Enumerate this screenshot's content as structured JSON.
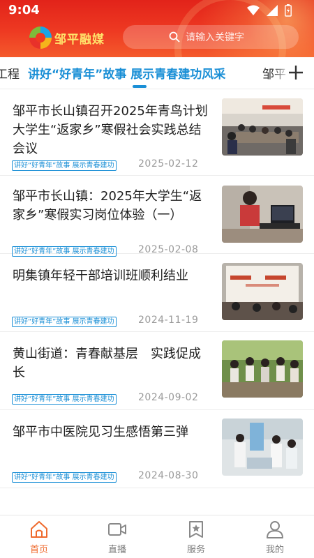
{
  "status_bar": {
    "time": "9:04"
  },
  "header": {
    "brand": "邹平融媒",
    "search_placeholder": "请输入关键字"
  },
  "tabs": {
    "prev": "工程",
    "active": "讲好“好青年”故事 展示青春建功风采",
    "next": "邹平"
  },
  "articles": [
    {
      "title": "邹平市长山镇召开2025年青鸟计划大学生“返家乡”寒假社会实践总结会议",
      "tag": "讲好“好青年”故事  展示青春建功",
      "date": "2025-02-12",
      "image": "meeting-room-photo"
    },
    {
      "title": "邹平市长山镇：2025年大学生“返家乡”寒假实习岗位体验（一）",
      "tag": "讲好“好青年”故事  展示青春建功",
      "date": "2025-02-08",
      "image": "student-laptop-photo"
    },
    {
      "title": "明集镇年轻干部培训班顺利结业",
      "tag": "讲好“好青年”故事  展示青春建功",
      "date": "2024-11-19",
      "image": "training-class-photo"
    },
    {
      "title": "黄山街道：青春献基层　实践促成长",
      "tag": "讲好“好青年”故事  展示青春建功",
      "date": "2024-09-02",
      "image": "group-outdoor-photo"
    },
    {
      "title": "邹平市中医院见习生感悟第三弹",
      "tag": "讲好“好青年”故事  展示青春建功",
      "date": "2024-08-30",
      "image": "hospital-photo"
    }
  ],
  "bottom_nav": [
    {
      "label": "首页",
      "icon": "home-icon",
      "active": true
    },
    {
      "label": "直播",
      "icon": "video-icon",
      "active": false
    },
    {
      "label": "服务",
      "icon": "bookmark-star-icon",
      "active": false
    },
    {
      "label": "我的",
      "icon": "person-icon",
      "active": false
    }
  ],
  "colors": {
    "header": "#ee3a22",
    "accent": "#1a8fd6",
    "nav_active": "#ef6a2d"
  }
}
